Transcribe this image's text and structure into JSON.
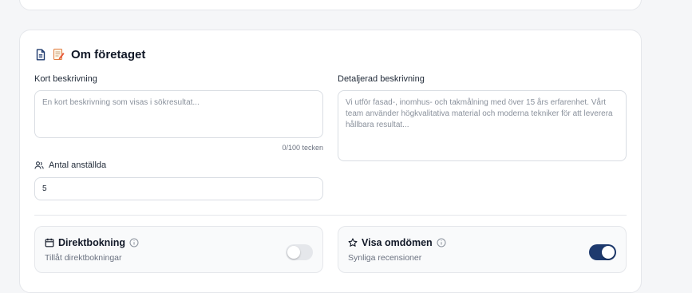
{
  "section": {
    "title": "Om företaget"
  },
  "short_description": {
    "label": "Kort beskrivning",
    "placeholder": "En kort beskrivning som visas i sökresultat...",
    "value": "",
    "counter": "0/100 tecken"
  },
  "detailed_description": {
    "label": "Detaljerad beskrivning",
    "placeholder": "Vi utför fasad-, inomhus- och takmålning med över 15 års erfarenhet. Vårt team använder högkvalitativa material och moderna tekniker för att leverera hållbara resultat...",
    "value": ""
  },
  "employees": {
    "label": "Antal anställda",
    "value": "5"
  },
  "toggles": [
    {
      "title": "Direktbokning",
      "subtitle": "Tillåt direktbokningar",
      "enabled": false
    },
    {
      "title": "Visa omdömen",
      "subtitle": "Synliga recensioner",
      "enabled": true
    }
  ],
  "colors": {
    "accent": "#1e3a6e",
    "toggle_off": "#e5e7eb",
    "border": "#e5e7eb"
  },
  "icons": {
    "section": [
      "document-icon",
      "memo-emoji-icon"
    ],
    "employees": "users-icon",
    "direct_booking": "calendar-icon",
    "show_reviews": "star-icon",
    "info": "info-icon"
  }
}
